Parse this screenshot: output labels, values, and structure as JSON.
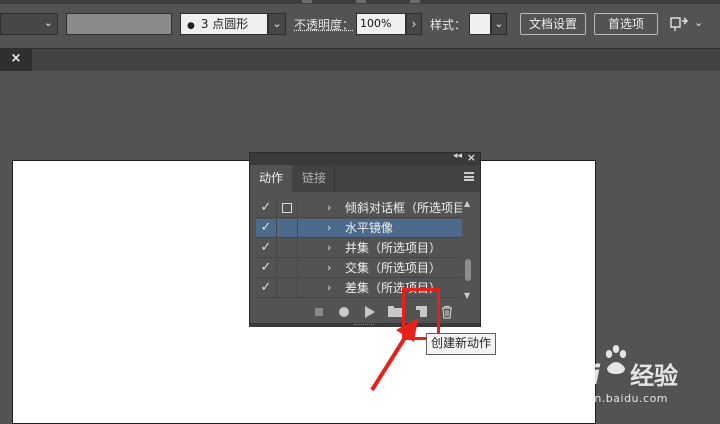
{
  "toolbar": {
    "stroke_profile": "3 点圆形",
    "opacity_label": "不透明度：",
    "opacity_value": "100%",
    "style_label": "样式：",
    "document_setup_label": "文档设置",
    "preferences_label": "首选项"
  },
  "actions_panel": {
    "tabs": [
      {
        "label": "动作",
        "active": true
      },
      {
        "label": "链接",
        "active": false
      }
    ],
    "rows": [
      {
        "label": "倾斜对话框（所选项目）",
        "checked": true,
        "dialog_toggle": true,
        "selected": false
      },
      {
        "label": "水平镜像",
        "checked": true,
        "dialog_toggle": false,
        "selected": true
      },
      {
        "label": "并集（所选项目）",
        "checked": true,
        "dialog_toggle": false,
        "selected": false
      },
      {
        "label": "交集（所选项目）",
        "checked": true,
        "dialog_toggle": false,
        "selected": false
      },
      {
        "label": "差集（所选项目）",
        "checked": true,
        "dialog_toggle": false,
        "selected": false
      }
    ],
    "bottom_icons": [
      "stop-icon",
      "record-icon",
      "play-icon",
      "folder-icon",
      "new-action-icon",
      "trash-icon"
    ],
    "tooltip": "创建新动作"
  },
  "annotation": {
    "highlight_color": "#e8201a"
  },
  "watermark": {
    "logo_text": "Bai",
    "logo_suffix": "经验",
    "url": "jingyan.baidu.com"
  },
  "colors": {
    "workspace": "#535353",
    "selected_row": "#4b6a8c",
    "artboard": "#ffffff"
  }
}
